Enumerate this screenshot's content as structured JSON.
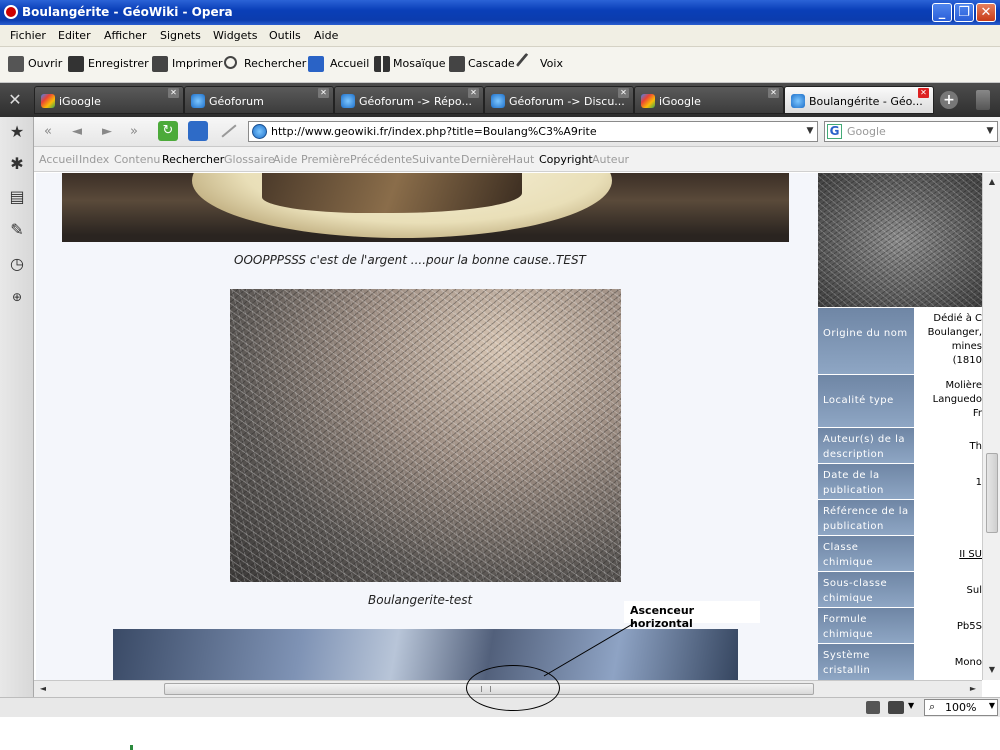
{
  "window": {
    "title": "Boulangérite - GéoWiki - Opera"
  },
  "menu": [
    "Fichier",
    "Editer",
    "Afficher",
    "Signets",
    "Widgets",
    "Outils",
    "Aide"
  ],
  "toolbar": [
    "Ouvrir",
    "Enregistrer",
    "Imprimer",
    "Rechercher",
    "Accueil",
    "Mosaïque",
    "Cascade",
    "Voix"
  ],
  "tabs": [
    {
      "label": "iGoogle"
    },
    {
      "label": "Géoforum"
    },
    {
      "label": "Géoforum -> Répo..."
    },
    {
      "label": "Géoforum -> Discu..."
    },
    {
      "label": "iGoogle"
    },
    {
      "label": "Boulangérite - Géo...",
      "active": true
    }
  ],
  "address": {
    "url": "http://www.geowiki.fr/index.php?title=Boulang%C3%A9rite",
    "search_placeholder": "Google"
  },
  "sitenav": [
    {
      "label": "Accueil",
      "enabled": false
    },
    {
      "label": "Index",
      "enabled": false
    },
    {
      "label": "Contenu",
      "enabled": false
    },
    {
      "label": "Rechercher",
      "enabled": true
    },
    {
      "label": "Glossaire",
      "enabled": false
    },
    {
      "label": "Aide",
      "enabled": false
    },
    {
      "label": "Première",
      "enabled": false
    },
    {
      "label": "Précédente",
      "enabled": false
    },
    {
      "label": "Suivante",
      "enabled": false
    },
    {
      "label": "Dernière",
      "enabled": false
    },
    {
      "label": "Haut",
      "enabled": false
    },
    {
      "label": "Copyright",
      "enabled": true
    },
    {
      "label": "Auteur",
      "enabled": false
    }
  ],
  "content": {
    "caption1": "OOOPPPSSS c'est de l'argent ....pour la bonne cause..TEST",
    "caption2": "Boulangerite-test"
  },
  "infobox": [
    {
      "key": "Origine du nom",
      "value_lines": [
        "Dédié à C",
        "Boulanger,",
        "mines",
        "(1810"
      ]
    },
    {
      "key": "Localité type",
      "value_lines": [
        "Molière",
        "Languedo",
        "Fr"
      ]
    },
    {
      "key": "Auteur(s) de la description",
      "value_lines": [
        "Th"
      ]
    },
    {
      "key": "Date de la publication",
      "value_lines": [
        "1"
      ]
    },
    {
      "key": "Référence de la publication",
      "value_lines": [
        ""
      ]
    },
    {
      "key": "Classe chimique",
      "value_lines": [
        "II SU"
      ],
      "link": true
    },
    {
      "key": "Sous-classe chimique",
      "value_lines": [
        "Sul"
      ]
    },
    {
      "key": "Formule chimique",
      "value_lines": [
        "Pb5S"
      ]
    },
    {
      "key": "Système cristallin",
      "value_lines": [
        "Mono"
      ]
    }
  ],
  "annotation": {
    "text": "Ascenceur horizontal"
  },
  "status": {
    "zoom": "100%"
  },
  "colors": {
    "titlebar": "#0a3fb8",
    "infobox_key": "#7d94b3",
    "tabbar": "#3a3a3a"
  }
}
